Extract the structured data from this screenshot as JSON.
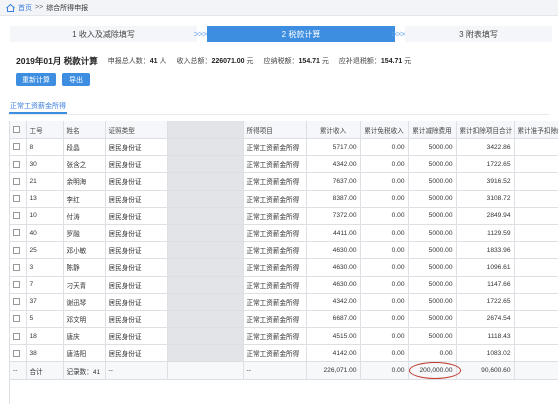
{
  "breadcrumb": {
    "home": "首页",
    "separator": ">>",
    "current": "综合所得申报"
  },
  "steps": [
    {
      "label": "1 收入及减除填写",
      "active": false
    },
    {
      "label": "2 税款计算",
      "active": true
    },
    {
      "label": "3 附表填写",
      "active": false
    }
  ],
  "step_separator": ">>>>",
  "summary": {
    "title": "2019年01月 税款计算",
    "count_label": "申报总人数：",
    "count_value": "41",
    "count_unit": "人",
    "income_label": "收入总额：",
    "income_value": "226071.00",
    "income_unit": "元",
    "tax_label": "应纳税额：",
    "tax_value": "154.71",
    "tax_unit": "元",
    "refund_label": "应补退税额：",
    "refund_value": "154.71",
    "refund_unit": "元"
  },
  "buttons": {
    "recalc": "重新计算",
    "export": "导出"
  },
  "subtab": "正常工资薪金所得",
  "table": {
    "headers": [
      "",
      "工号",
      "姓名",
      "证照类型",
      "",
      "所得项目",
      "累计收入",
      "累计免税收入",
      "累计减除费用",
      "累计扣除项目合计",
      "累计准予扣除的"
    ],
    "rows": [
      {
        "id": "8",
        "name": "段晶",
        "idtype": "居民身份证",
        "item": "正常工资薪金所得",
        "income": "5717.00",
        "exempt": "0.00",
        "deduct": "5000.00",
        "total": "3422.86"
      },
      {
        "id": "30",
        "name": "张含之",
        "idtype": "居民身份证",
        "item": "正常工资薪金所得",
        "income": "4342.00",
        "exempt": "0.00",
        "deduct": "5000.00",
        "total": "1722.65"
      },
      {
        "id": "21",
        "name": "余明海",
        "idtype": "居民身份证",
        "item": "正常工资薪金所得",
        "income": "7637.00",
        "exempt": "0.00",
        "deduct": "5000.00",
        "total": "3916.52"
      },
      {
        "id": "13",
        "name": "李红",
        "idtype": "居民身份证",
        "item": "正常工资薪金所得",
        "income": "8387.00",
        "exempt": "0.00",
        "deduct": "5000.00",
        "total": "3108.72"
      },
      {
        "id": "10",
        "name": "付涛",
        "idtype": "居民身份证",
        "item": "正常工资薪金所得",
        "income": "7372.00",
        "exempt": "0.00",
        "deduct": "5000.00",
        "total": "2849.94"
      },
      {
        "id": "40",
        "name": "罗融",
        "idtype": "居民身份证",
        "item": "正常工资薪金所得",
        "income": "4411.00",
        "exempt": "0.00",
        "deduct": "5000.00",
        "total": "1129.59"
      },
      {
        "id": "25",
        "name": "邓小敏",
        "idtype": "居民身份证",
        "item": "正常工资薪金所得",
        "income": "4630.00",
        "exempt": "0.00",
        "deduct": "5000.00",
        "total": "1833.96"
      },
      {
        "id": "3",
        "name": "陈静",
        "idtype": "居民身份证",
        "item": "正常工资薪金所得",
        "income": "4630.00",
        "exempt": "0.00",
        "deduct": "5000.00",
        "total": "1096.61"
      },
      {
        "id": "7",
        "name": "刁天青",
        "idtype": "居民身份证",
        "item": "正常工资薪金所得",
        "income": "4630.00",
        "exempt": "0.00",
        "deduct": "5000.00",
        "total": "1147.66"
      },
      {
        "id": "37",
        "name": "谢迅琴",
        "idtype": "居民身份证",
        "item": "正常工资薪金所得",
        "income": "4342.00",
        "exempt": "0.00",
        "deduct": "5000.00",
        "total": "1722.65"
      },
      {
        "id": "5",
        "name": "邓文明",
        "idtype": "居民身份证",
        "item": "正常工资薪金所得",
        "income": "6687.00",
        "exempt": "0.00",
        "deduct": "5000.00",
        "total": "2674.54"
      },
      {
        "id": "18",
        "name": "唐庆",
        "idtype": "居民身份证",
        "item": "正常工资薪金所得",
        "income": "4515.00",
        "exempt": "0.00",
        "deduct": "5000.00",
        "total": "1118.43"
      },
      {
        "id": "38",
        "name": "唐浩阳",
        "idtype": "居民身份证",
        "item": "正常工资薪金所得",
        "income": "4142.00",
        "exempt": "0.00",
        "deduct": "0.00",
        "total": "1083.02"
      }
    ],
    "total_row": {
      "dash": "--",
      "label": "合计",
      "count": "记录数：41",
      "col3": "--",
      "col4": "--",
      "col5": "--",
      "income": "226,071.00",
      "exempt": "0.00",
      "deduct": "200,000.00",
      "total": "90,600.60"
    }
  },
  "colors": {
    "accent": "#3d8ee0",
    "highlight_circle": "#c0392b"
  }
}
